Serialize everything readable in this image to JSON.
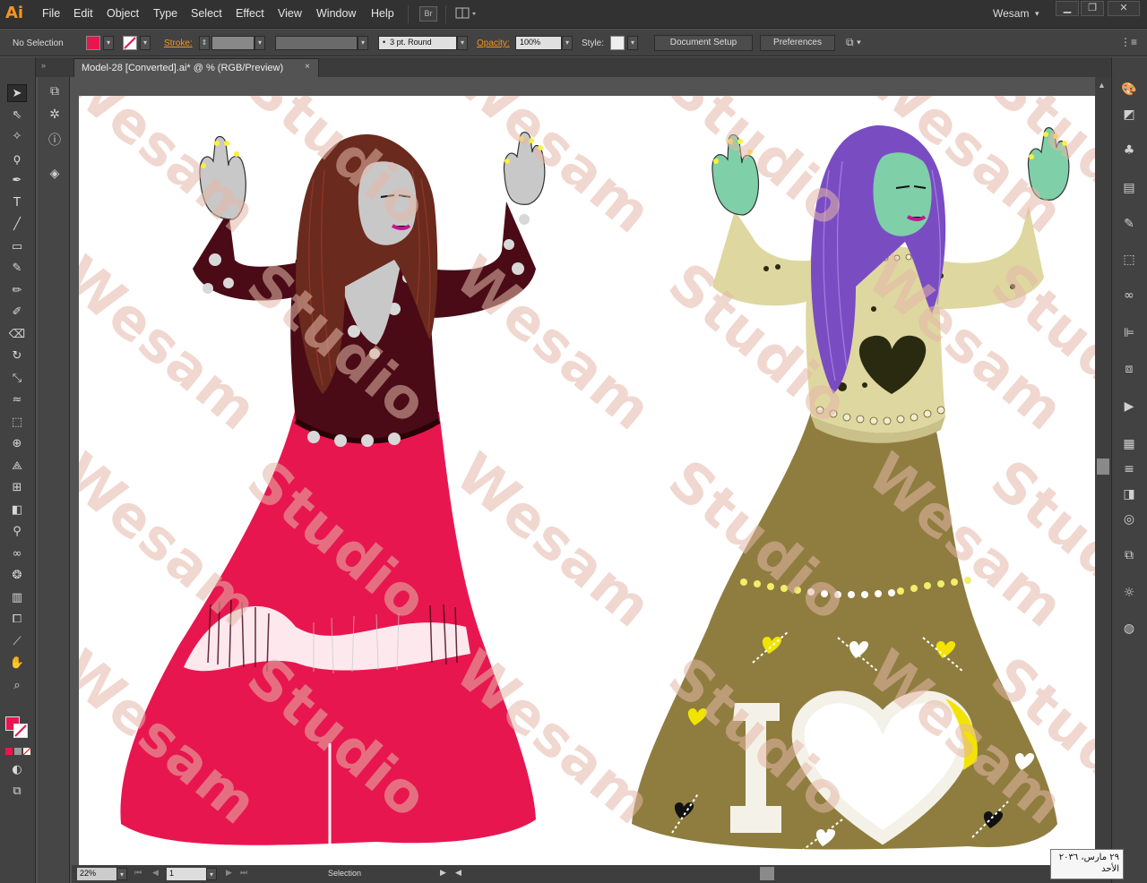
{
  "app": {
    "logo": "Ai",
    "user": "Wesam",
    "user_caret": "▾"
  },
  "menu": [
    "File",
    "Edit",
    "Object",
    "Type",
    "Select",
    "Effect",
    "View",
    "Window",
    "Help"
  ],
  "bridge_button": "Br",
  "control": {
    "selection": "No Selection",
    "stroke_label": "Stroke:",
    "brush": "3 pt. Round",
    "opacity_label": "Opacity:",
    "opacity_value": "100%",
    "style_label": "Style:",
    "document_setup": "Document Setup",
    "preferences": "Preferences"
  },
  "tab": {
    "title": "Model-28 [Converted].ai* @ % (RGB/Preview)",
    "close": "×"
  },
  "status": {
    "zoom": "22%",
    "page": "1",
    "tool": "Selection"
  },
  "date_box": {
    "line1": "٢٩ مارس، ٢٠٣٦",
    "line2": "الأحد"
  },
  "watermark": {
    "word1": "Wesam",
    "word2": "Studio"
  },
  "artwork": {
    "left_figure": {
      "hair": "#6b2a1e",
      "skin": "#c8c8c8",
      "top": "#4a0b16",
      "skirt": "#e8164f"
    },
    "right_figure": {
      "hair": "#7a4cc2",
      "skin": "#7fcfa8",
      "top": "#ded7a0",
      "skirt": "#8f7d3f",
      "heart_text": "I"
    }
  },
  "tools_left": [
    "selection-icon",
    "direct-selection-icon",
    "magic-wand-icon",
    "lasso-icon",
    "pen-icon",
    "type-icon",
    "line-icon",
    "rectangle-icon",
    "paintbrush-icon",
    "pencil-icon",
    "blob-brush-icon",
    "eraser-icon",
    "rotate-icon",
    "scale-icon",
    "warp-icon",
    "free-transform-icon",
    "shape-builder-icon",
    "perspective-icon",
    "mesh-icon",
    "gradient-icon",
    "eyedropper-icon",
    "blend-icon",
    "symbol-sprayer-icon",
    "graph-icon",
    "artboard-icon",
    "slice-icon",
    "hand-icon",
    "zoom-icon"
  ],
  "colors": {
    "fill": "#e8164f",
    "accent": "#f7941d"
  }
}
